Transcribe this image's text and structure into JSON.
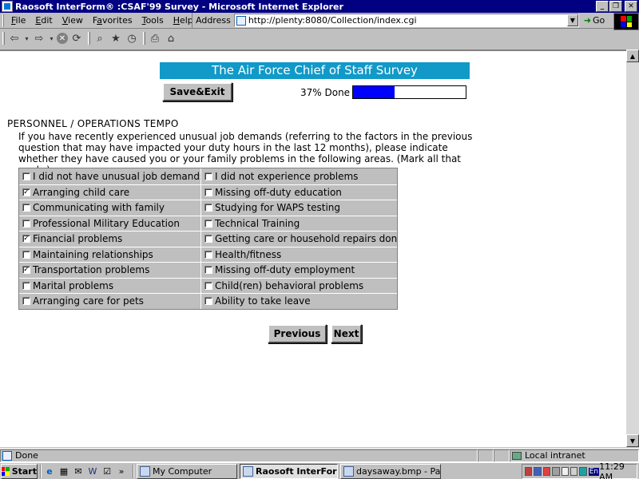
{
  "window": {
    "title": "Raosoft InterForm® :CSAF'99 Survey - Microsoft Internet Explorer",
    "minimize_icon": "minimize-icon",
    "restore_icon": "restore-icon",
    "close_icon": "close-icon"
  },
  "menu": {
    "items": [
      {
        "key": "F",
        "rest": "ile"
      },
      {
        "key": "E",
        "rest": "dit"
      },
      {
        "key": "V",
        "rest": "iew"
      },
      {
        "pre": "F",
        "key": "a",
        "rest": "vorites"
      },
      {
        "key": "T",
        "rest": "ools"
      },
      {
        "key": "H",
        "rest": "elp"
      }
    ]
  },
  "address": {
    "label": "Address",
    "url": "http://plenty:8080/Collection/index.cgi",
    "go_label": "Go"
  },
  "toolbar": {
    "icons": [
      "back-icon",
      "forward-icon",
      "stop-icon",
      "refresh-icon",
      "search-icon",
      "favorites-icon",
      "history-icon",
      "print-icon",
      "home-icon"
    ]
  },
  "survey": {
    "title": "The Air Force Chief of Staff Survey",
    "save_exit_label": "Save&Exit",
    "progress_label": "37% Done",
    "progress_fraction": 0.37,
    "section_title": "PERSONNEL / OPERATIONS TEMPO",
    "question": "If you have recently experienced unusual job demands (referring to the factors in the previous question that may have impacted your duty hours in the last 12 months), please indicate whether they have caused you or your family problems in the following areas. (Mark all that apply.)",
    "options": [
      [
        {
          "label": "I did not have unusual job demands",
          "checked": false
        },
        {
          "label": "I did not experience problems",
          "checked": false
        }
      ],
      [
        {
          "label": "Arranging child care",
          "checked": true
        },
        {
          "label": "Missing off-duty education",
          "checked": false
        }
      ],
      [
        {
          "label": "Communicating with family",
          "checked": false
        },
        {
          "label": "Studying for WAPS testing",
          "checked": false
        }
      ],
      [
        {
          "label": "Professional Military Education",
          "checked": false
        },
        {
          "label": "Technical Training",
          "checked": false
        }
      ],
      [
        {
          "label": "Financial problems",
          "checked": true
        },
        {
          "label": "Getting care or household repairs done",
          "checked": false
        }
      ],
      [
        {
          "label": "Maintaining relationships",
          "checked": false
        },
        {
          "label": "Health/fitness",
          "checked": false
        }
      ],
      [
        {
          "label": "Transportation problems",
          "checked": true
        },
        {
          "label": "Missing off-duty employment",
          "checked": false
        }
      ],
      [
        {
          "label": "Marital problems",
          "checked": false
        },
        {
          "label": "Child(ren) behavioral problems",
          "checked": false
        }
      ],
      [
        {
          "label": "Arranging care for pets",
          "checked": false
        },
        {
          "label": "Ability to take leave",
          "checked": false
        }
      ]
    ],
    "previous_label": "Previous",
    "next_label": "Next"
  },
  "status": {
    "text": "Done",
    "zone": "Local intranet"
  },
  "taskbar": {
    "start_label": "Start",
    "more_label": "»",
    "tasks": [
      {
        "label": "My Computer",
        "active": false
      },
      {
        "label": "Raosoft InterForm...",
        "active": true
      },
      {
        "label": "daysaway.bmp - Paint",
        "active": false
      }
    ],
    "tray_lang": "En",
    "clock": "11:29 AM"
  }
}
